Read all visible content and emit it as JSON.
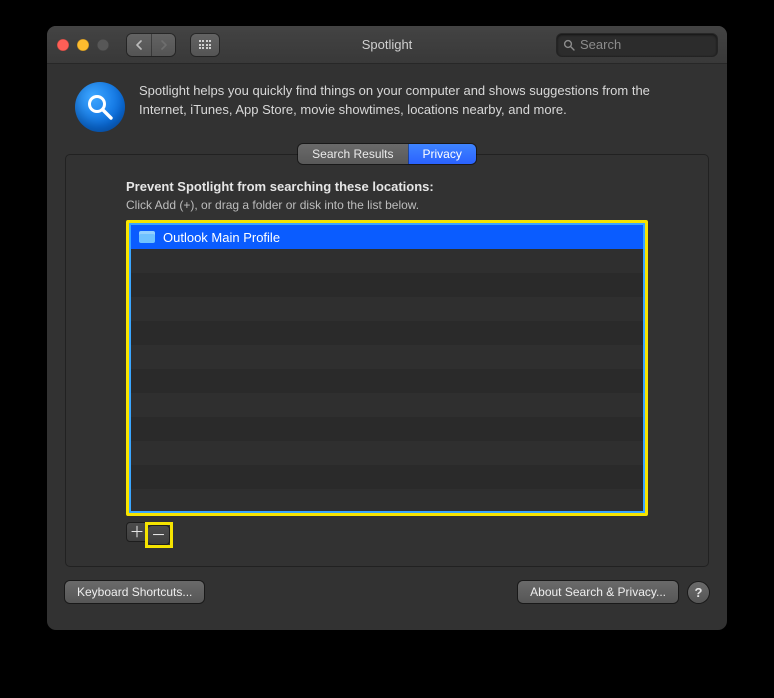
{
  "window_title": "Spotlight",
  "search_placeholder": "Search",
  "intro": "Spotlight helps you quickly find things on your computer and shows suggestions from the Internet, iTunes, App Store, movie showtimes, locations nearby, and more.",
  "tabs": {
    "search_results": "Search Results",
    "privacy": "Privacy"
  },
  "pane": {
    "heading": "Prevent Spotlight from searching these locations:",
    "hint": "Click Add (+), or drag a folder or disk into the list below.",
    "items": [
      {
        "label": "Outlook Main Profile",
        "selected": true
      }
    ]
  },
  "footer": {
    "shortcuts": "Keyboard Shortcuts...",
    "about": "About Search & Privacy...",
    "help": "?"
  }
}
